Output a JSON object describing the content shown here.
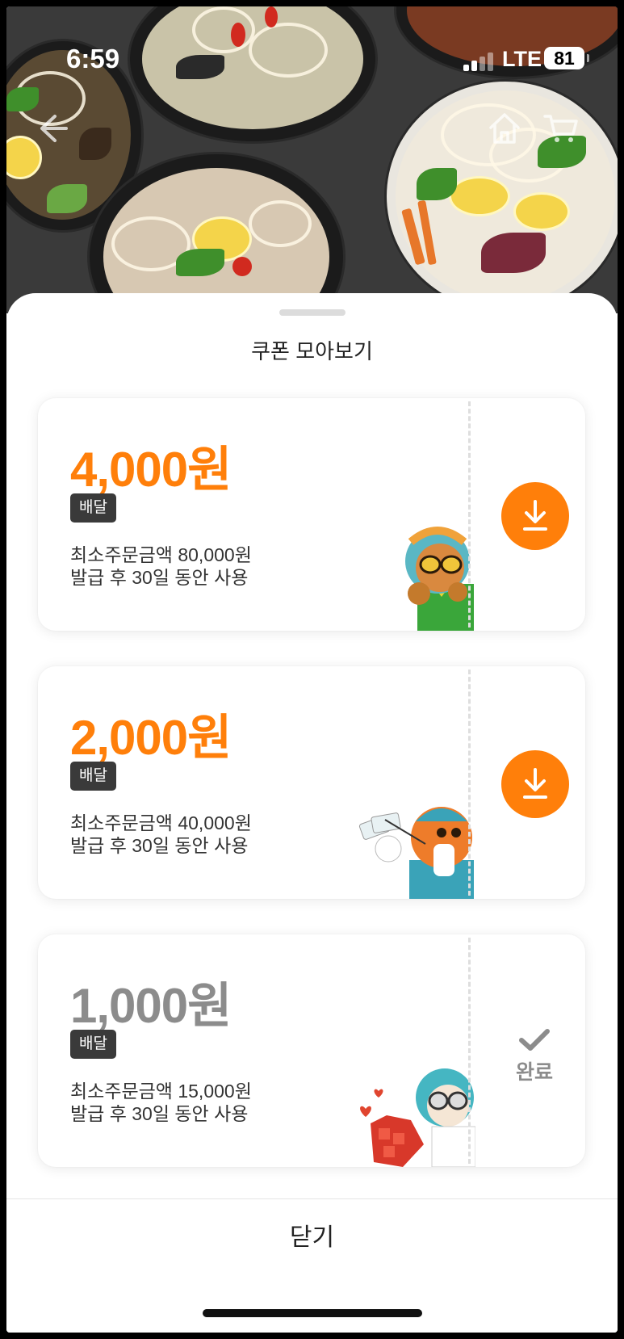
{
  "status_bar": {
    "time": "6:59",
    "network": "LTE",
    "battery": "81"
  },
  "hero": {
    "back_icon": "back-arrow-icon",
    "home_icon": "home-icon",
    "cart_icon": "cart-icon"
  },
  "sheet": {
    "title": "쿠폰 모아보기",
    "close_label": "닫기"
  },
  "coupons": [
    {
      "amount": "4,000원",
      "type": "배달",
      "min_order": "최소주문금액 80,000원",
      "validity": "발급 후 30일 동안 사용",
      "state": "download"
    },
    {
      "amount": "2,000원",
      "type": "배달",
      "min_order": "최소주문금액 40,000원",
      "validity": "발급 후 30일 동안 사용",
      "state": "download"
    },
    {
      "amount": "1,000원",
      "type": "배달",
      "min_order": "최소주문금액 15,000원",
      "validity": "발급 후 30일 동안 사용",
      "state": "done",
      "done_label": "완료"
    }
  ],
  "colors": {
    "accent": "#ff7f0a",
    "done": "#8c8c8c",
    "badge": "#3a3a3a"
  }
}
